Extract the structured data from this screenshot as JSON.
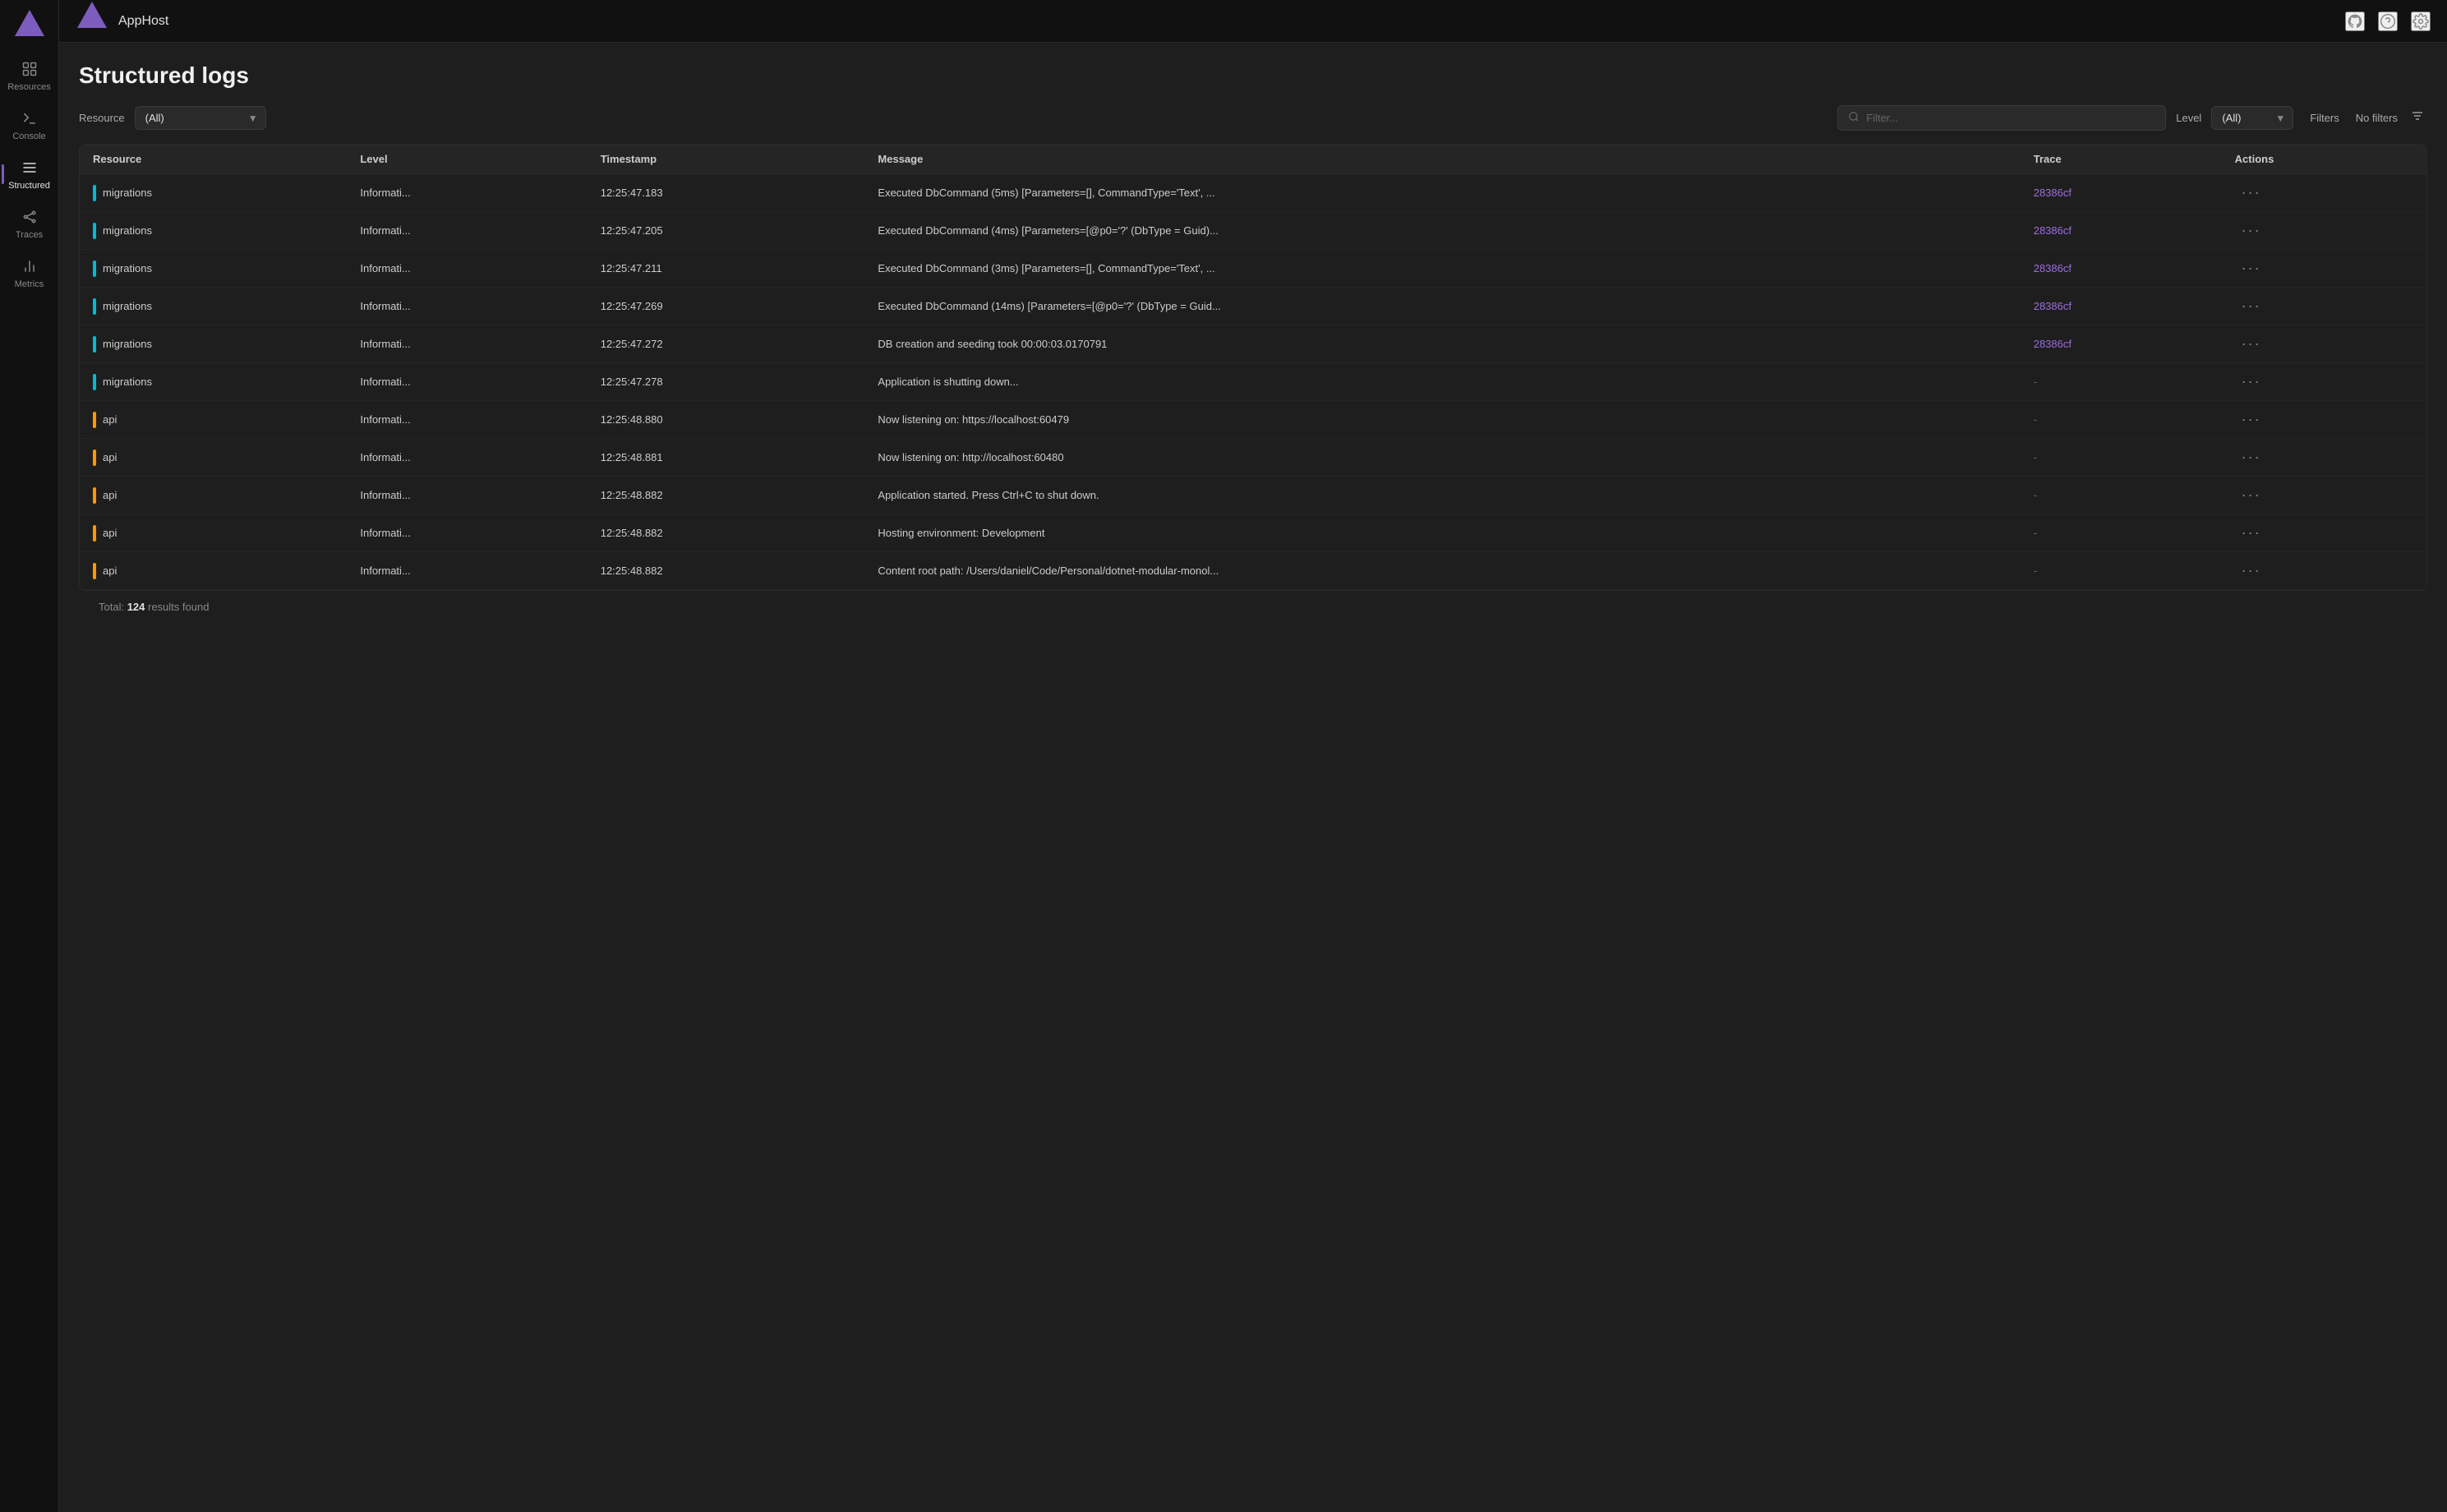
{
  "app": {
    "title": "AppHost"
  },
  "sidebar": {
    "items": [
      {
        "id": "resources",
        "label": "Resources",
        "active": false
      },
      {
        "id": "console",
        "label": "Console",
        "active": false
      },
      {
        "id": "structured",
        "label": "Structured",
        "active": true
      },
      {
        "id": "traces",
        "label": "Traces",
        "active": false
      },
      {
        "id": "metrics",
        "label": "Metrics",
        "active": false
      }
    ]
  },
  "page": {
    "title": "Structured logs"
  },
  "filters": {
    "resource_label": "Resource",
    "resource_value": "(All)",
    "search_placeholder": "Filter...",
    "level_label": "Level",
    "level_value": "(All)",
    "filters_btn": "Filters",
    "no_filters": "No filters"
  },
  "table": {
    "columns": [
      "Resource",
      "Level",
      "Timestamp",
      "Message",
      "Trace",
      "Actions"
    ],
    "rows": [
      {
        "resource": "migrations",
        "resource_color": "teal",
        "level": "Informati...",
        "timestamp": "12:25:47.183",
        "message": "Executed DbCommand (5ms) [Parameters=[], CommandType='Text', ...",
        "trace": "28386cf",
        "trace_link": true,
        "actions": "..."
      },
      {
        "resource": "migrations",
        "resource_color": "teal",
        "level": "Informati...",
        "timestamp": "12:25:47.205",
        "message": "Executed DbCommand (4ms) [Parameters=[@p0='?' (DbType = Guid)...",
        "trace": "28386cf",
        "trace_link": true,
        "actions": "..."
      },
      {
        "resource": "migrations",
        "resource_color": "teal",
        "level": "Informati...",
        "timestamp": "12:25:47.211",
        "message": "Executed DbCommand (3ms) [Parameters=[], CommandType='Text', ...",
        "trace": "28386cf",
        "trace_link": true,
        "actions": "..."
      },
      {
        "resource": "migrations",
        "resource_color": "teal",
        "level": "Informati...",
        "timestamp": "12:25:47.269",
        "message": "Executed DbCommand (14ms) [Parameters=[@p0='?' (DbType = Guid...",
        "trace": "28386cf",
        "trace_link": true,
        "actions": "..."
      },
      {
        "resource": "migrations",
        "resource_color": "teal",
        "level": "Informati...",
        "timestamp": "12:25:47.272",
        "message": "DB creation and seeding took 00:00:03.0170791",
        "trace": "28386cf",
        "trace_link": true,
        "actions": "..."
      },
      {
        "resource": "migrations",
        "resource_color": "teal",
        "level": "Informati...",
        "timestamp": "12:25:47.278",
        "message": "Application is shutting down...",
        "trace": "-",
        "trace_link": false,
        "actions": "..."
      },
      {
        "resource": "api",
        "resource_color": "orange",
        "level": "Informati...",
        "timestamp": "12:25:48.880",
        "message": "Now listening on: https://localhost:60479",
        "trace": "-",
        "trace_link": false,
        "actions": "..."
      },
      {
        "resource": "api",
        "resource_color": "orange",
        "level": "Informati...",
        "timestamp": "12:25:48.881",
        "message": "Now listening on: http://localhost:60480",
        "trace": "-",
        "trace_link": false,
        "actions": "..."
      },
      {
        "resource": "api",
        "resource_color": "orange",
        "level": "Informati...",
        "timestamp": "12:25:48.882",
        "message": "Application started. Press Ctrl+C to shut down.",
        "trace": "-",
        "trace_link": false,
        "actions": "..."
      },
      {
        "resource": "api",
        "resource_color": "orange",
        "level": "Informati...",
        "timestamp": "12:25:48.882",
        "message": "Hosting environment: Development",
        "trace": "-",
        "trace_link": false,
        "actions": "..."
      },
      {
        "resource": "api",
        "resource_color": "orange",
        "level": "Informati...",
        "timestamp": "12:25:48.882",
        "message": "Content root path: /Users/daniel/Code/Personal/dotnet-modular-monol...",
        "trace": "-",
        "trace_link": false,
        "actions": "..."
      }
    ]
  },
  "footer": {
    "prefix": "Total: ",
    "count": "124",
    "suffix": " results found"
  },
  "icons": {
    "github": "⊕",
    "help": "?",
    "settings": "⚙",
    "search": "🔍",
    "filter": "≡"
  }
}
